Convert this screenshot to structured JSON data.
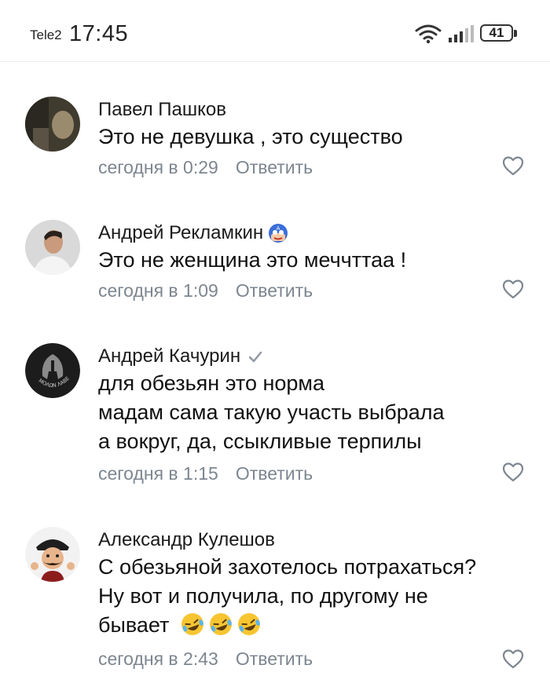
{
  "status_bar": {
    "carrier": "Tele2",
    "time": "17:45",
    "battery": "41"
  },
  "comments": [
    {
      "author": "Павел Пашков",
      "lines": [
        "Это не девушка , это существо"
      ],
      "date": "сегодня в 0:29",
      "reply": "Ответить"
    },
    {
      "author": "Андрей Рекламкин",
      "lines": [
        "Это не женщина это меччттаа !"
      ],
      "date": "сегодня в 1:09",
      "reply": "Ответить"
    },
    {
      "author": "Андрей Качурин",
      "lines": [
        "для обезьян это норма",
        "мадам сама такую участь выбрала",
        "а вокруг, да, ссыкливые терпилы"
      ],
      "date": "сегодня в 1:15",
      "reply": "Ответить",
      "avatar_text": "ΜΟΛΩΝ ΛΑΒΕ"
    },
    {
      "author": "Александр Кулешов",
      "lines": [
        "С обезьяной захотелось потрахаться?",
        "Ну вот и получила, по другому не",
        "бывает"
      ],
      "date": "сегодня в 2:43",
      "reply": "Ответить"
    }
  ],
  "icons": {
    "wifi": "wifi-icon",
    "signal": "signal-bars-icon",
    "like": "heart-outline-icon",
    "verified": "checkmark-icon",
    "emoji": "rolling-laughing-emoji"
  },
  "colors": {
    "meta_text": "#7d8690",
    "accent_blue": "#3a6fd8"
  }
}
